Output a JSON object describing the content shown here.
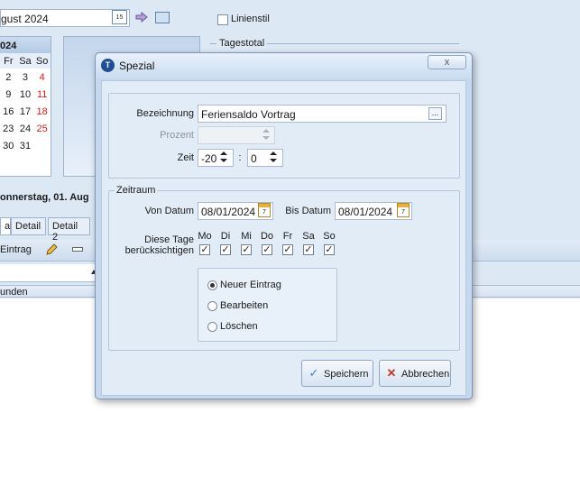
{
  "app": {
    "date_value": "gust 2024",
    "date_icon_text": "15",
    "linienstil_label": "Linienstil",
    "tagestotal_label": "Tagestotal",
    "mini_cal": {
      "year": "024",
      "dow": [
        "Fr",
        "Sa",
        "So"
      ],
      "rows": [
        [
          "2",
          "3",
          "4"
        ],
        [
          "9",
          "10",
          "11"
        ],
        [
          "16",
          "17",
          "18"
        ],
        [
          "23",
          "24",
          "25"
        ],
        [
          "30",
          "31",
          ""
        ]
      ]
    },
    "date_title": "onnerstag, 01. Aug",
    "tabs": [
      "al",
      "Detail",
      "Detail 2"
    ],
    "toolbar_label": "Eintrag",
    "column_header": "unden"
  },
  "dialog": {
    "icon_text": "T",
    "title": "Spezial",
    "close_label": "x",
    "bezeichnung_label": "Bezeichnung",
    "bezeichnung_value": "Feriensaldo Vortrag",
    "ellipsis": "...",
    "prozent_label": "Prozent",
    "prozent_value": "",
    "zeit_label": "Zeit",
    "zeit_hours": "-20",
    "zeit_sep": ":",
    "zeit_minutes": "0",
    "zeitraum_label": "Zeitraum",
    "von_label": "Von Datum",
    "von_value": "08/01/2024",
    "bis_label": "Bis Datum",
    "bis_value": "08/01/2024",
    "cal_icon_text": "7",
    "days_label_1": "Diese Tage",
    "days_label_2": "berücksichtigen",
    "days": [
      {
        "label": "Mo",
        "checked": true
      },
      {
        "label": "Di",
        "checked": true
      },
      {
        "label": "Mi",
        "checked": true
      },
      {
        "label": "Do",
        "checked": true
      },
      {
        "label": "Fr",
        "checked": true
      },
      {
        "label": "Sa",
        "checked": true
      },
      {
        "label": "So",
        "checked": true
      }
    ],
    "check_mark": "✓",
    "options": [
      {
        "label": "Neuer Eintrag",
        "selected": true
      },
      {
        "label": "Bearbeiten",
        "selected": false
      },
      {
        "label": "Löschen",
        "selected": false
      }
    ],
    "save_label": "Speichern",
    "cancel_label": "Abbrechen",
    "colors": {
      "save_check": "#3a7bd5",
      "cancel_x": "#c0392b"
    }
  }
}
